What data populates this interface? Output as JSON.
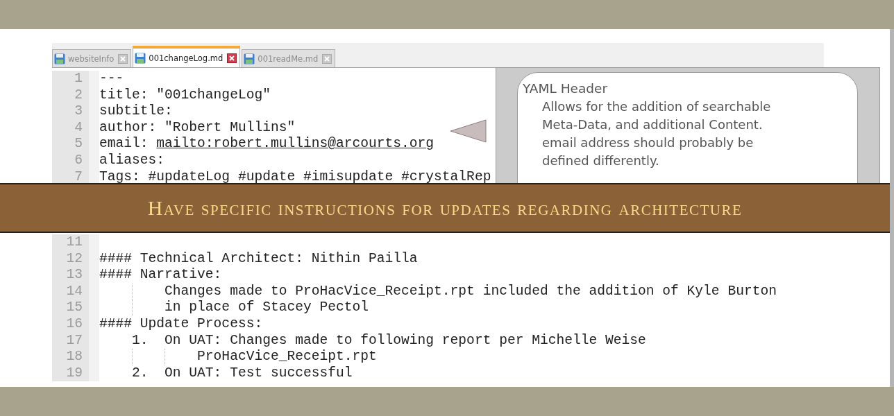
{
  "tabs": [
    {
      "label": "websiteInfo",
      "selected": false
    },
    {
      "label": "001changeLog.md",
      "selected": true
    },
    {
      "label": "001readMe.md",
      "selected": false
    }
  ],
  "editor": {
    "lines_top": [
      {
        "number": "1",
        "text": "---"
      },
      {
        "number": "2",
        "text": "title: \"001changeLog\""
      },
      {
        "number": "3",
        "text": "subtitle:"
      },
      {
        "number": "4",
        "text": "author: \"Robert Mullins\""
      },
      {
        "number": "5",
        "text": "email: ",
        "link": "mailto:robert.mullins@arcourts.org"
      },
      {
        "number": "6",
        "text": "aliases:"
      },
      {
        "number": "7",
        "text": "Tags: #updateLog #update #imisupdate #crystalRep"
      }
    ],
    "lines_bottom": [
      {
        "number": "11"
      },
      {
        "number": "12",
        "text": "#### Technical Architect: Nithin Pailla"
      },
      {
        "number": "13",
        "text": "#### Narrative:"
      },
      {
        "number": "14",
        "text": "        Changes made to ProHacVice_Receipt.rpt included the addition of Kyle Burton"
      },
      {
        "number": "15",
        "text": "        in place of Stacey Pectol"
      },
      {
        "number": "16",
        "text": "#### Update Process:"
      },
      {
        "number": "17",
        "text": "    1.  On UAT: Changes made to following report per Michelle Weise"
      },
      {
        "number": "18",
        "text": "            ProHacVice_Receipt.rpt"
      },
      {
        "number": "19",
        "text": "    2.  On UAT: Test successful"
      }
    ]
  },
  "callout": {
    "title": "YAML Header",
    "body": "Allows for the addition of searchable Meta-Data, and additional Content. email address should probably be defined differently."
  },
  "banner": {
    "text": "Have specific instructions for updates regarding architecture"
  }
}
